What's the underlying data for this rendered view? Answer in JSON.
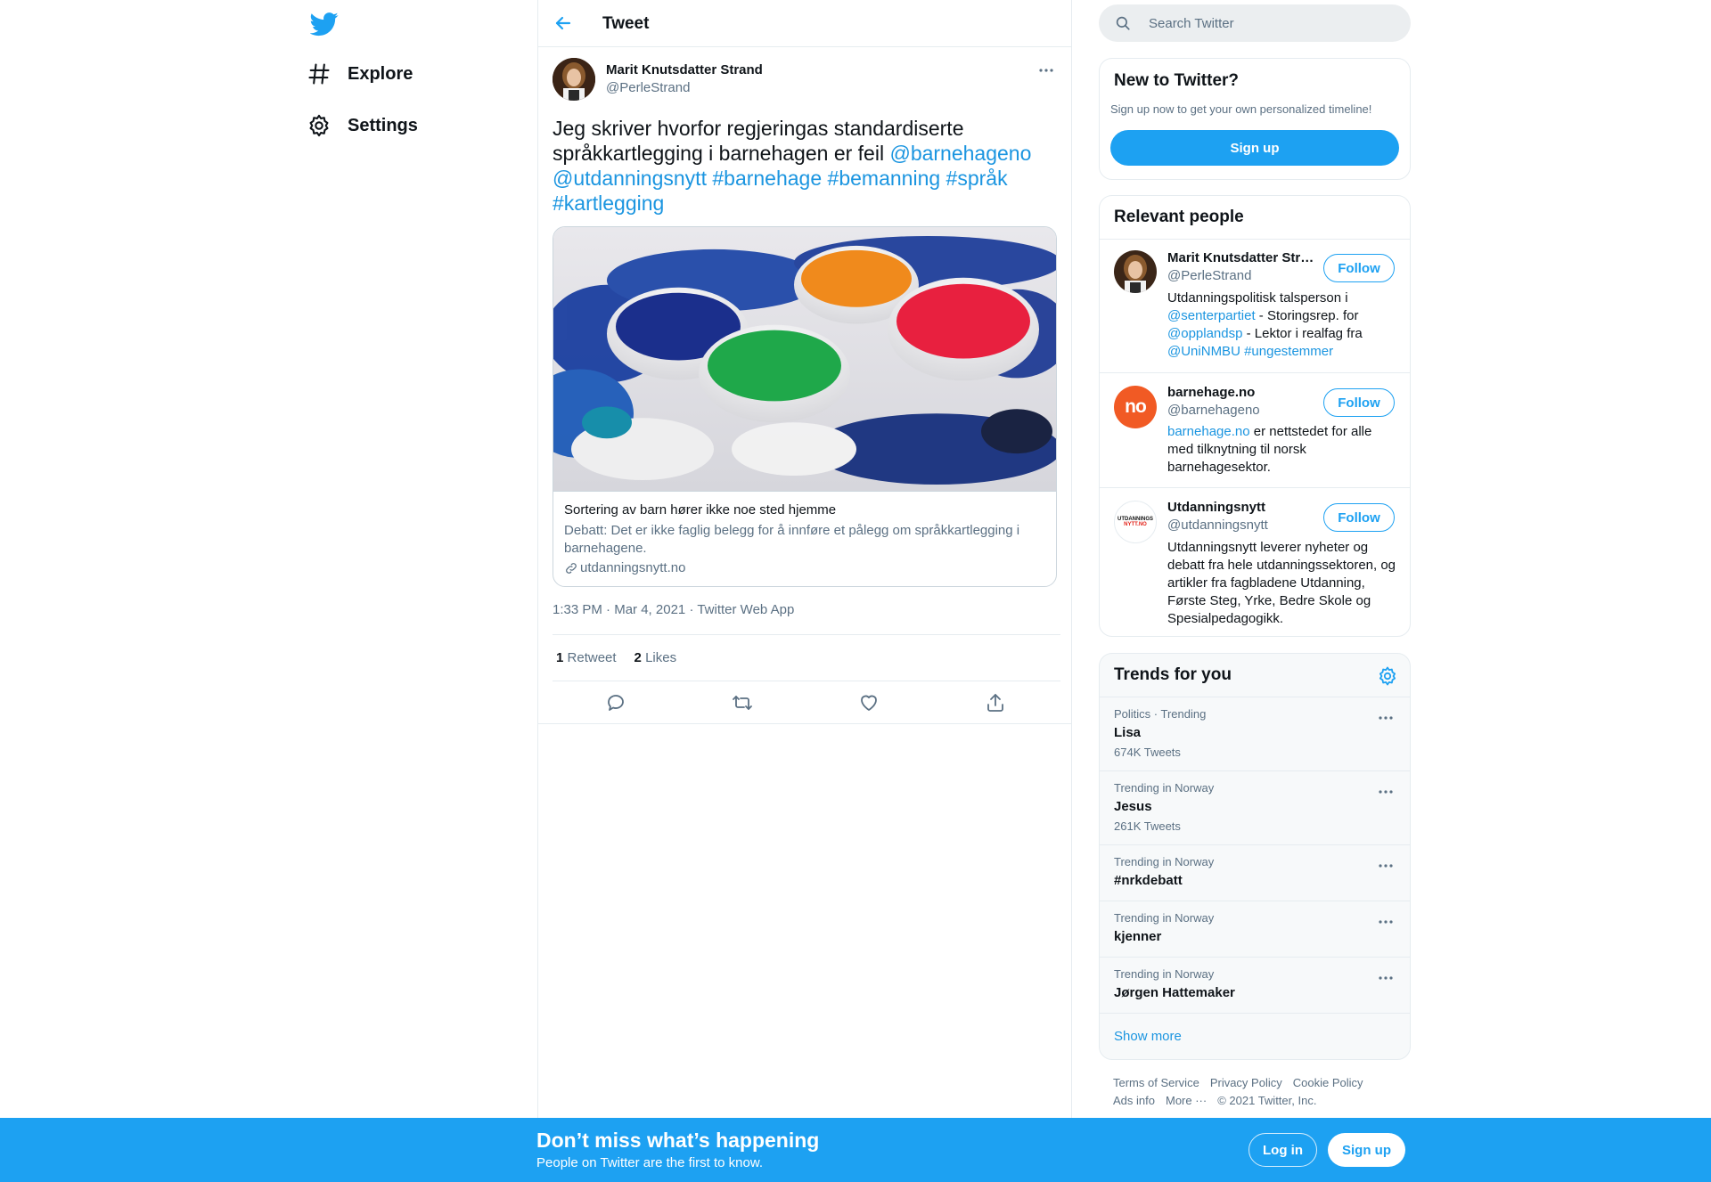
{
  "nav": {
    "logo_icon": "twitter-bird-icon",
    "items": [
      {
        "label": "Explore",
        "icon": "hashtag-icon"
      },
      {
        "label": "Settings",
        "icon": "gear-icon"
      }
    ]
  },
  "header": {
    "title": "Tweet",
    "back_icon": "arrow-left-icon"
  },
  "tweet": {
    "author_name": "Marit Knutsdatter Strand",
    "author_handle": "@PerleStrand",
    "text_plain": "Jeg skriver hvorfor regjeringas standardiserte språkkartlegging i barnehagen er feil",
    "links": [
      "@barnehageno",
      "@utdanningsnytt",
      "#barnehage",
      "#bemanning",
      "#språk",
      "#kartlegging"
    ],
    "card": {
      "title": "Sortering av barn hører ikke noe sted hjemme",
      "description": "Debatt: Det er ikke faglig belegg for å innføre et pålegg om språkkartlegging i barnehagene.",
      "domain": "utdanningsnytt.no"
    },
    "time": "1:33 PM",
    "date": "Mar 4, 2021",
    "source": "Twitter Web App",
    "separator": "·",
    "retweet_count": "1",
    "retweet_label": "Retweet",
    "like_count": "2",
    "like_label": "Likes",
    "actions": [
      "reply-icon",
      "retweet-icon",
      "like-icon",
      "share-icon"
    ]
  },
  "search": {
    "placeholder": "Search Twitter"
  },
  "new_to_twitter": {
    "title": "New to Twitter?",
    "subtitle": "Sign up now to get your own personalized timeline!",
    "button": "Sign up"
  },
  "relevant_people": {
    "title": "Relevant people",
    "follow_label": "Follow",
    "people": [
      {
        "name": "Marit Knutsdatter Strand",
        "handle": "@PerleStrand",
        "bio_parts": [
          "Utdanningspolitisk talsperson i ",
          "@senterpartiet",
          " - Storingsrep. for ",
          "@opplandsp",
          " - Lektor i realfag fra ",
          "@UniNMBU",
          " ",
          "#ungestemmer"
        ]
      },
      {
        "name": "barnehage.no",
        "handle": "@barnehageno",
        "avatar_text": "no",
        "bio_parts": [
          "barnehage.no",
          " er nettstedet for alle med tilknytning til norsk barnehagesektor."
        ]
      },
      {
        "name": "Utdanningsnytt",
        "handle": "@utdanningsnytt",
        "avatar_text_1": "UTDANNINGS",
        "avatar_text_2": "NYTT.NO",
        "bio": "Utdanningsnytt leverer nyheter og debatt fra hele utdanningssektoren, og artikler fra fagbladene Utdanning, Første Steg, Yrke, Bedre Skole og Spesialpedagogikk."
      }
    ]
  },
  "trends": {
    "title": "Trends for you",
    "items": [
      {
        "context": "Politics · Trending",
        "name": "Lisa",
        "count": "674K Tweets"
      },
      {
        "context": "Trending in Norway",
        "name": "Jesus",
        "count": "261K Tweets"
      },
      {
        "context": "Trending in Norway",
        "name": "#nrkdebatt",
        "count": ""
      },
      {
        "context": "Trending in Norway",
        "name": "kjenner",
        "count": ""
      },
      {
        "context": "Trending in Norway",
        "name": "Jørgen Hattemaker",
        "count": ""
      }
    ],
    "show_more": "Show more"
  },
  "footer": {
    "links": [
      "Terms of Service",
      "Privacy Policy",
      "Cookie Policy",
      "Ads info",
      "More ···"
    ],
    "copyright": "© 2021 Twitter, Inc."
  },
  "bottom_bar": {
    "title": "Don’t miss what’s happening",
    "subtitle": "People on Twitter are the first to know.",
    "login": "Log in",
    "signup": "Sign up"
  },
  "colors": {
    "accent": "#1da1f2",
    "link": "#1b95e0",
    "muted": "#5b7083",
    "border": "#e6ecf0"
  }
}
